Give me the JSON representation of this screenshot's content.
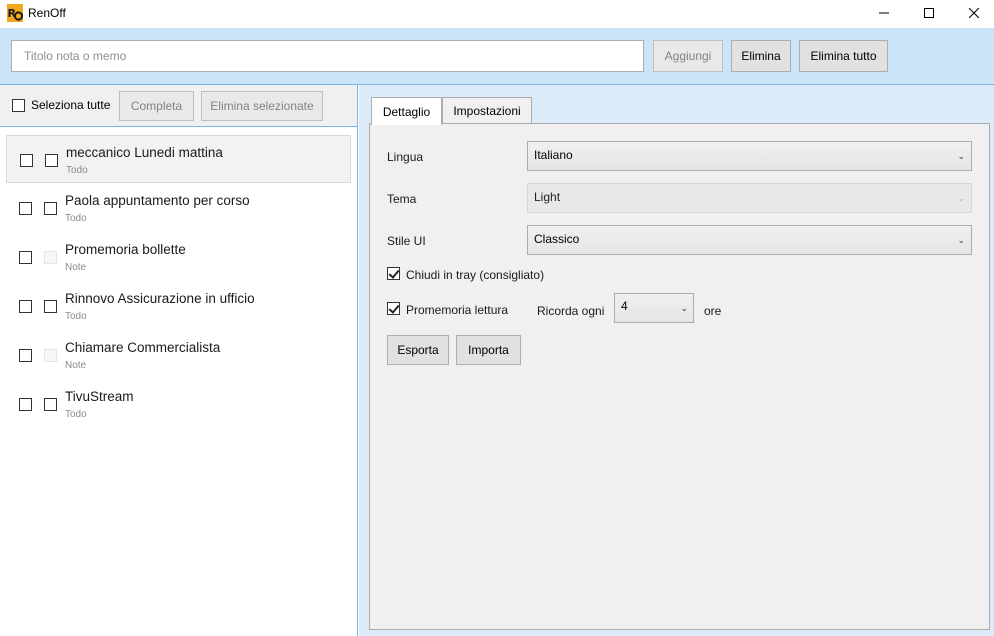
{
  "window": {
    "title": "RenOff",
    "logo_text": "RO",
    "minimize": "—",
    "maximize": "☐",
    "close": "✕"
  },
  "toolbar": {
    "title_placeholder": "Titolo nota o memo",
    "title_value": "",
    "add_label": "Aggiungi",
    "delete_label": "Elimina",
    "delete_all_label": "Elimina tutto"
  },
  "left": {
    "select_all_label": "Seleziona tutte",
    "complete_label": "Completa",
    "delete_selected_label": "Elimina selezionate",
    "items": [
      {
        "title": "meccanico Lunedi mattina",
        "type": "Todo",
        "selected": true
      },
      {
        "title": "Paola appuntamento per corso",
        "type": "Todo",
        "selected": false
      },
      {
        "title": "Promemoria bollette",
        "type": "Note",
        "selected": false
      },
      {
        "title": "Rinnovo Assicurazione in ufficio",
        "type": "Todo",
        "selected": false
      },
      {
        "title": "Chiamare Commercialista",
        "type": "Note",
        "selected": false
      },
      {
        "title": "TivuStream",
        "type": "Todo",
        "selected": false
      }
    ]
  },
  "tabs": {
    "detail": "Dettaglio",
    "settings": "Impostazioni"
  },
  "settings": {
    "language_label": "Lingua",
    "language_value": "Italiano",
    "theme_label": "Tema",
    "theme_value": "Light",
    "ui_style_label": "Stile UI",
    "ui_style_value": "Classico",
    "tray_label": "Chiudi in tray (consigliato)",
    "tray_checked": true,
    "reminder_label": "Promemoria lettura",
    "reminder_checked": true,
    "remind_every_label": "Ricorda ogni",
    "remind_every_value": "4",
    "hours_label": "ore",
    "export_label": "Esporta",
    "import_label": "Importa"
  },
  "colors": {
    "accent_light": "#cce4f7",
    "panel_bg": "#dcebfa",
    "border_accent": "#7eb4ea"
  }
}
